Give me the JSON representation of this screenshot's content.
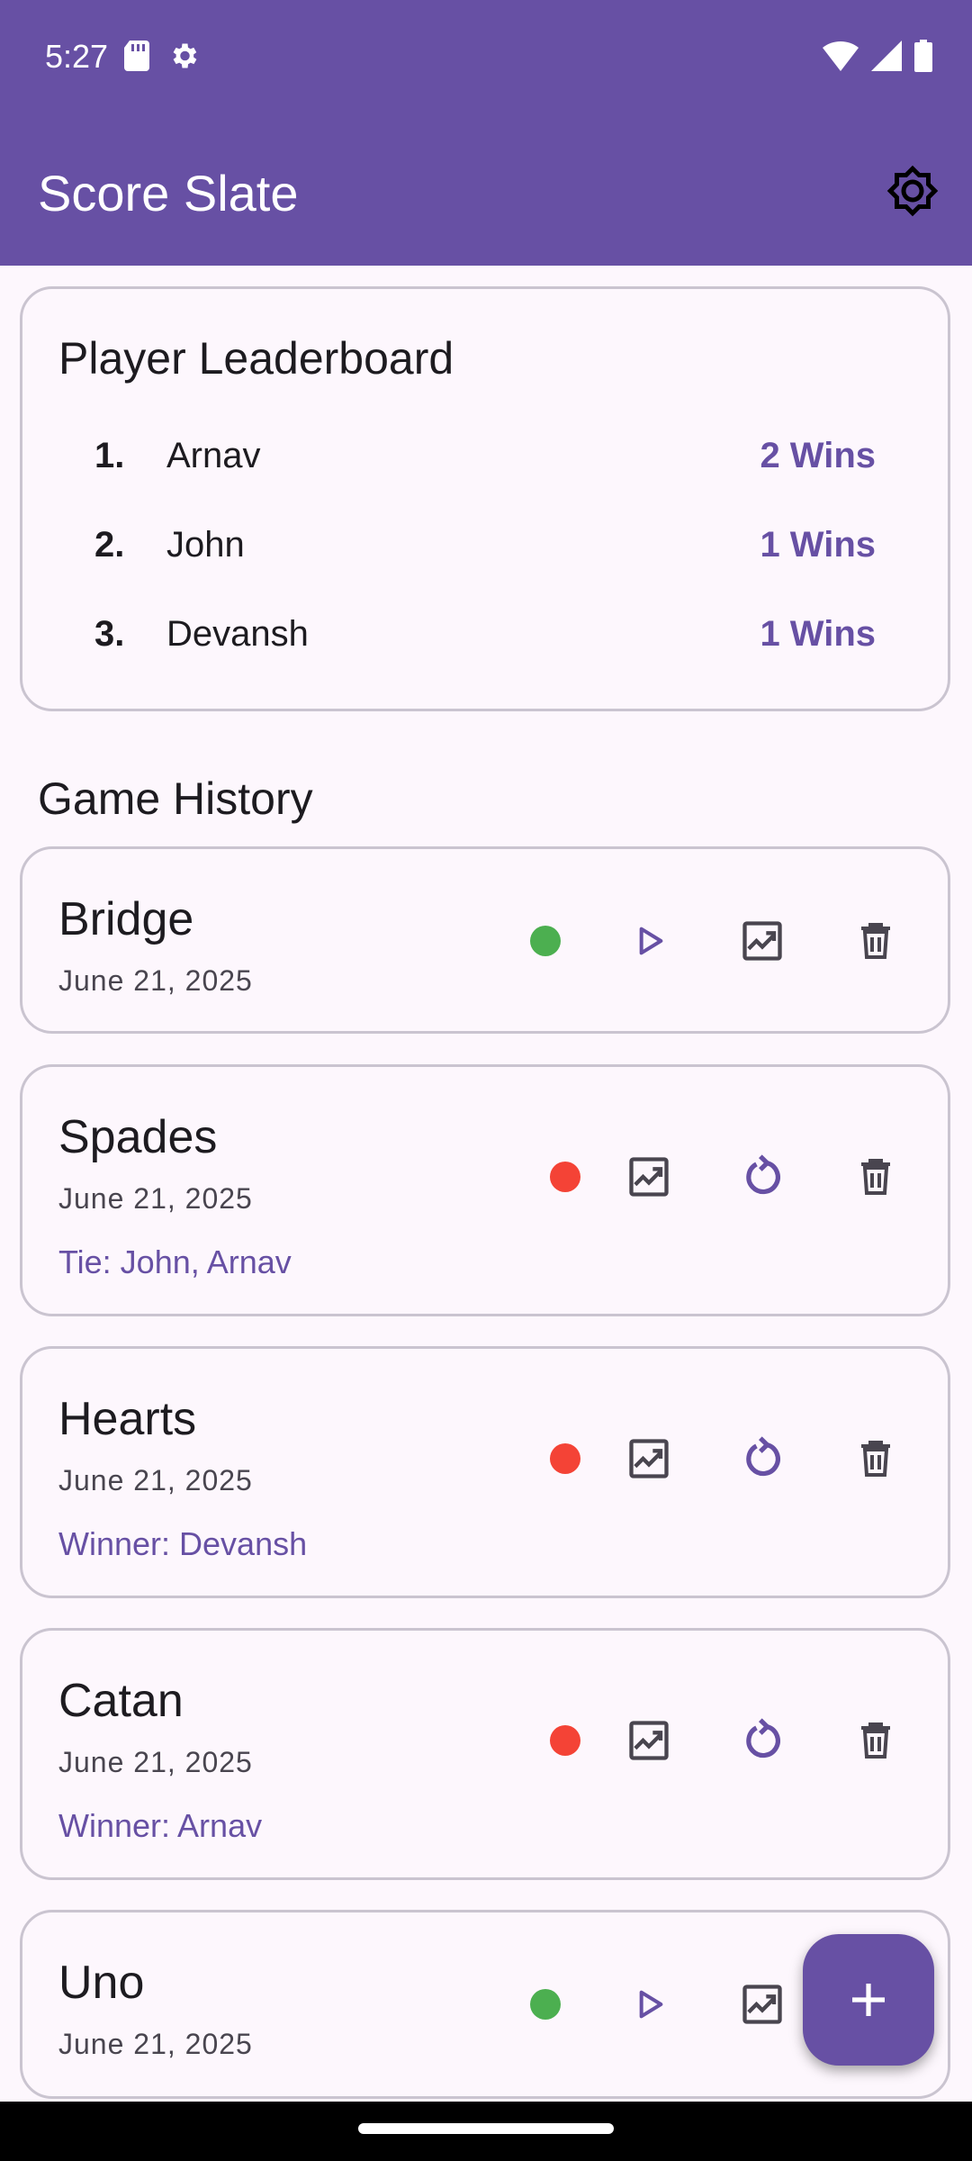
{
  "status_bar": {
    "time": "5:27"
  },
  "app_bar": {
    "title": "Score Slate"
  },
  "leaderboard": {
    "title": "Player Leaderboard",
    "rows": [
      {
        "rank": "1.",
        "name": "Arnav",
        "wins": "2 Wins"
      },
      {
        "rank": "2.",
        "name": "John",
        "wins": "1 Wins"
      },
      {
        "rank": "3.",
        "name": "Devansh",
        "wins": "1 Wins"
      }
    ]
  },
  "history": {
    "title": "Game History",
    "games": [
      {
        "name": "Bridge",
        "date": "June 21, 2025",
        "result": "",
        "status": "active",
        "status_color": "#4CAF50"
      },
      {
        "name": "Spades",
        "date": "June 21, 2025",
        "result": "Tie: John, Arnav",
        "status": "finished",
        "status_color": "#F44336"
      },
      {
        "name": "Hearts",
        "date": "June 21, 2025",
        "result": "Winner: Devansh",
        "status": "finished",
        "status_color": "#F44336"
      },
      {
        "name": "Catan",
        "date": "June 21, 2025",
        "result": "Winner: Arnav",
        "status": "finished",
        "status_color": "#F44336"
      },
      {
        "name": "Uno",
        "date": "June 21, 2025",
        "result": "",
        "status": "active",
        "status_color": "#4CAF50"
      }
    ]
  },
  "icons": {
    "settings": "brightness-gear-icon",
    "play": "play-icon",
    "chart": "trending-chart-icon",
    "restart": "restart-icon",
    "delete": "trash-icon",
    "add": "plus-icon"
  },
  "colors": {
    "primary": "#6750A4",
    "active": "#4CAF50",
    "finished": "#F44336"
  }
}
